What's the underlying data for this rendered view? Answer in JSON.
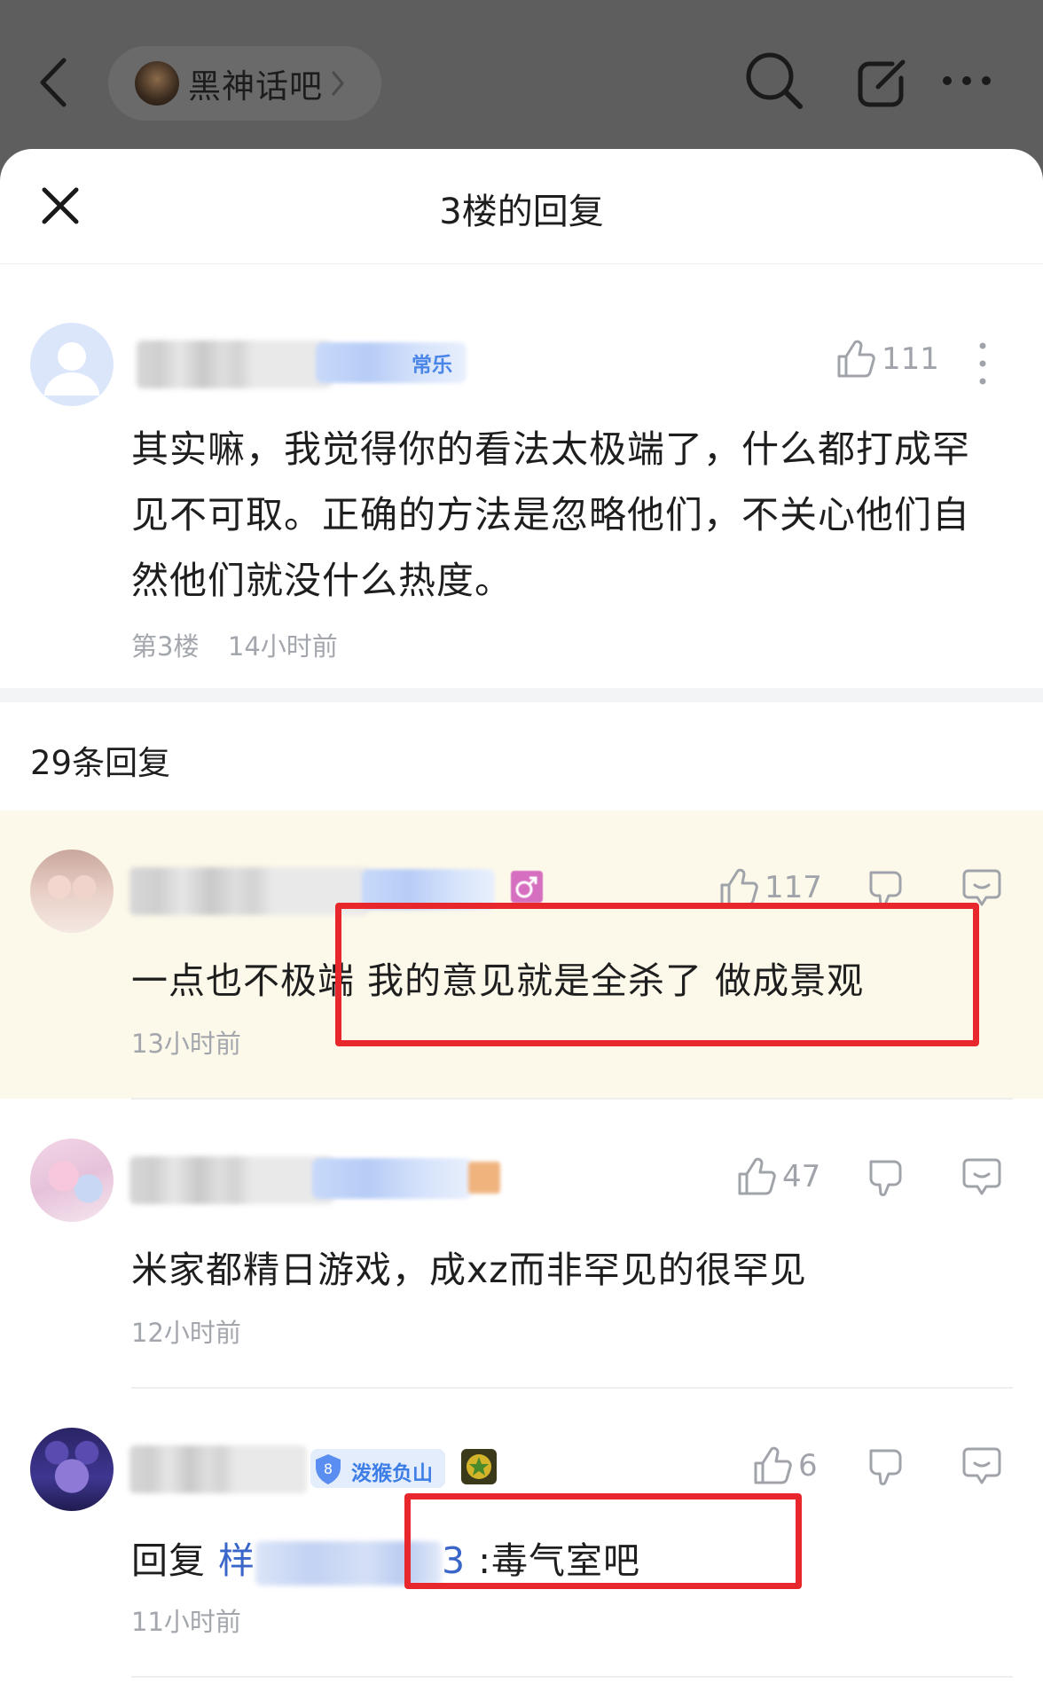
{
  "top_bar": {
    "forum_name": "黑神话吧"
  },
  "sheet": {
    "title": "3楼的回复"
  },
  "main_post": {
    "username_visible": "",
    "badge_text": "常乐",
    "likes": "111",
    "text": "其实嘛，我觉得你的看法太极端了，什么都打成罕见不可取。正确的方法是忽略他们，不关心他们自然他们就没什么热度。",
    "floor": "第3楼",
    "time": "14小时前"
  },
  "replies_header": {
    "count_label": "29条回复"
  },
  "replies": [
    {
      "likes": "117",
      "text_prefix": "一点也不极",
      "text_highlight": "端 我的意见就是全杀了 做成景观",
      "time": "13小时前"
    },
    {
      "likes": "47",
      "text": "米家都精日游戏，成xz而非罕见的很罕见",
      "time": "12小时前"
    },
    {
      "badge_text": "泼猴负山",
      "likes": "6",
      "reply_word": "回复",
      "mention_start": "样",
      "mention_end": "3",
      "text": ":毒气室吧",
      "time": "11小时前"
    }
  ],
  "colors": {
    "accent_blue": "#4a86e8",
    "highlight_bg": "#fdf9ea",
    "annotation_red": "#e8272d"
  }
}
